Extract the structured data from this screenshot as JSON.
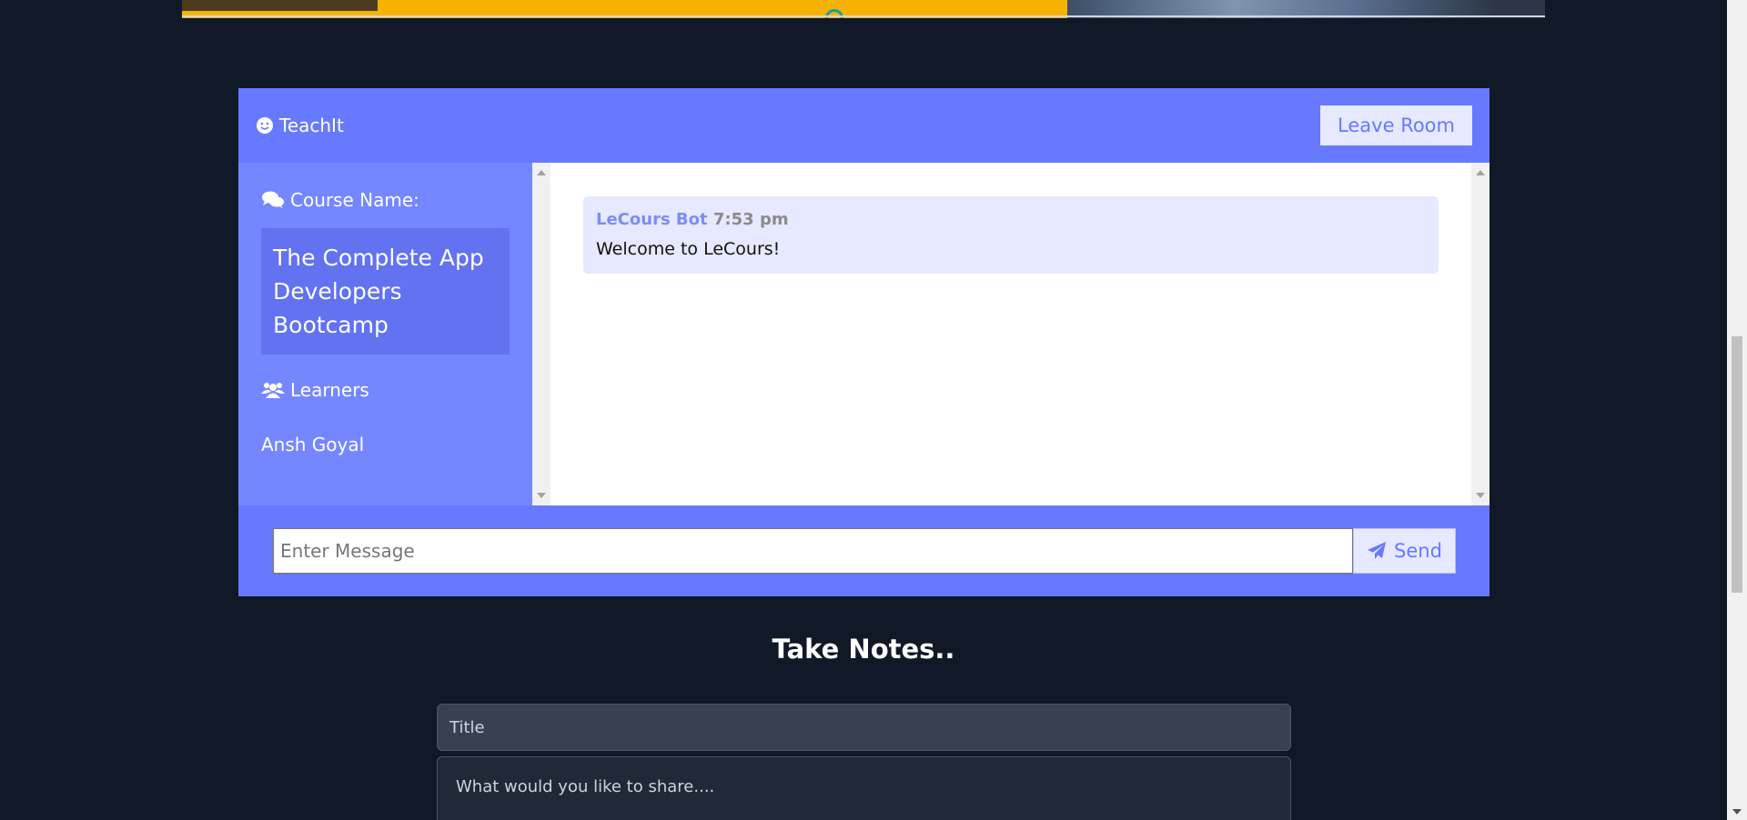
{
  "header": {
    "brand": "TeachIt",
    "leave_label": "Leave Room"
  },
  "sidebar": {
    "course_heading": "Course Name:",
    "course_name": "The Complete App Developers Bootcamp",
    "learners_heading": "Learners",
    "users": [
      "Ansh Goyal"
    ]
  },
  "messages": [
    {
      "user": "LeCours Bot",
      "time": "7:53 pm",
      "text": "Welcome to LeCours!"
    }
  ],
  "chat_form": {
    "placeholder": "Enter Message",
    "send_label": "Send"
  },
  "notes": {
    "heading": "Take Notes..",
    "title_placeholder": "Title",
    "body_placeholder": "What would you like to share...."
  },
  "colors": {
    "accent": "#6779ff",
    "background": "#111827"
  }
}
